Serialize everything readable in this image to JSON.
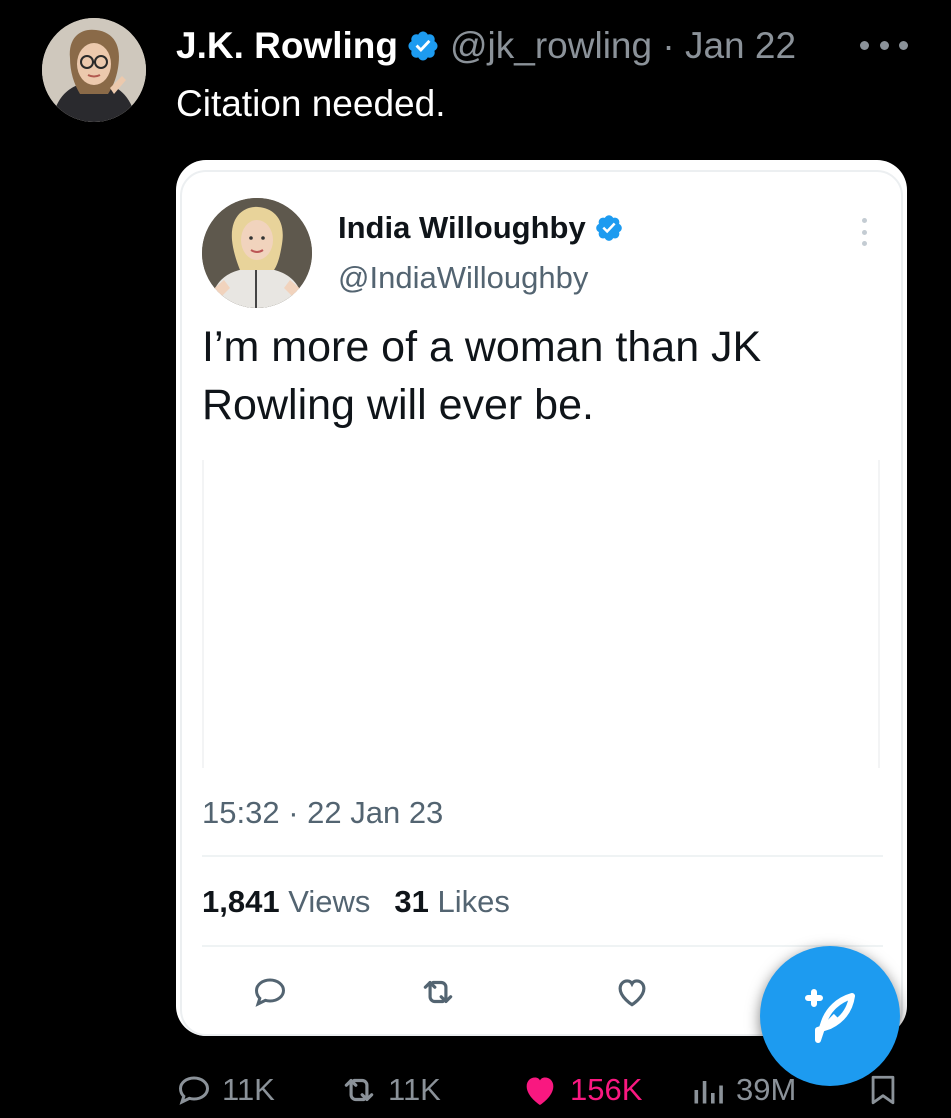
{
  "tweet": {
    "author_name": "J.K. Rowling",
    "author_handle": "@jk_rowling",
    "separator": "·",
    "date": "Jan 22",
    "text": "Citation needed."
  },
  "quoted_tweet": {
    "author_name": "India Willoughby",
    "author_handle": "@IndiaWilloughby",
    "text": "I’m more of a woman than JK Rowling will ever be.",
    "timestamp": "15:32 · 22 Jan 23",
    "views_count": "1,841",
    "views_label": "Views",
    "likes_count": "31",
    "likes_label": "Likes"
  },
  "engagement": {
    "replies": "11K",
    "retweets": "11K",
    "likes": "156K",
    "views": "39M"
  },
  "colors": {
    "background": "#000000",
    "verified": "#1d9bf0",
    "like_active": "#f91880",
    "muted": "#8b9299"
  },
  "icons": [
    "verified-badge-icon",
    "more-icon",
    "reply-icon",
    "retweet-icon",
    "heart-icon",
    "views-icon",
    "bookmark-icon",
    "compose-icon"
  ]
}
